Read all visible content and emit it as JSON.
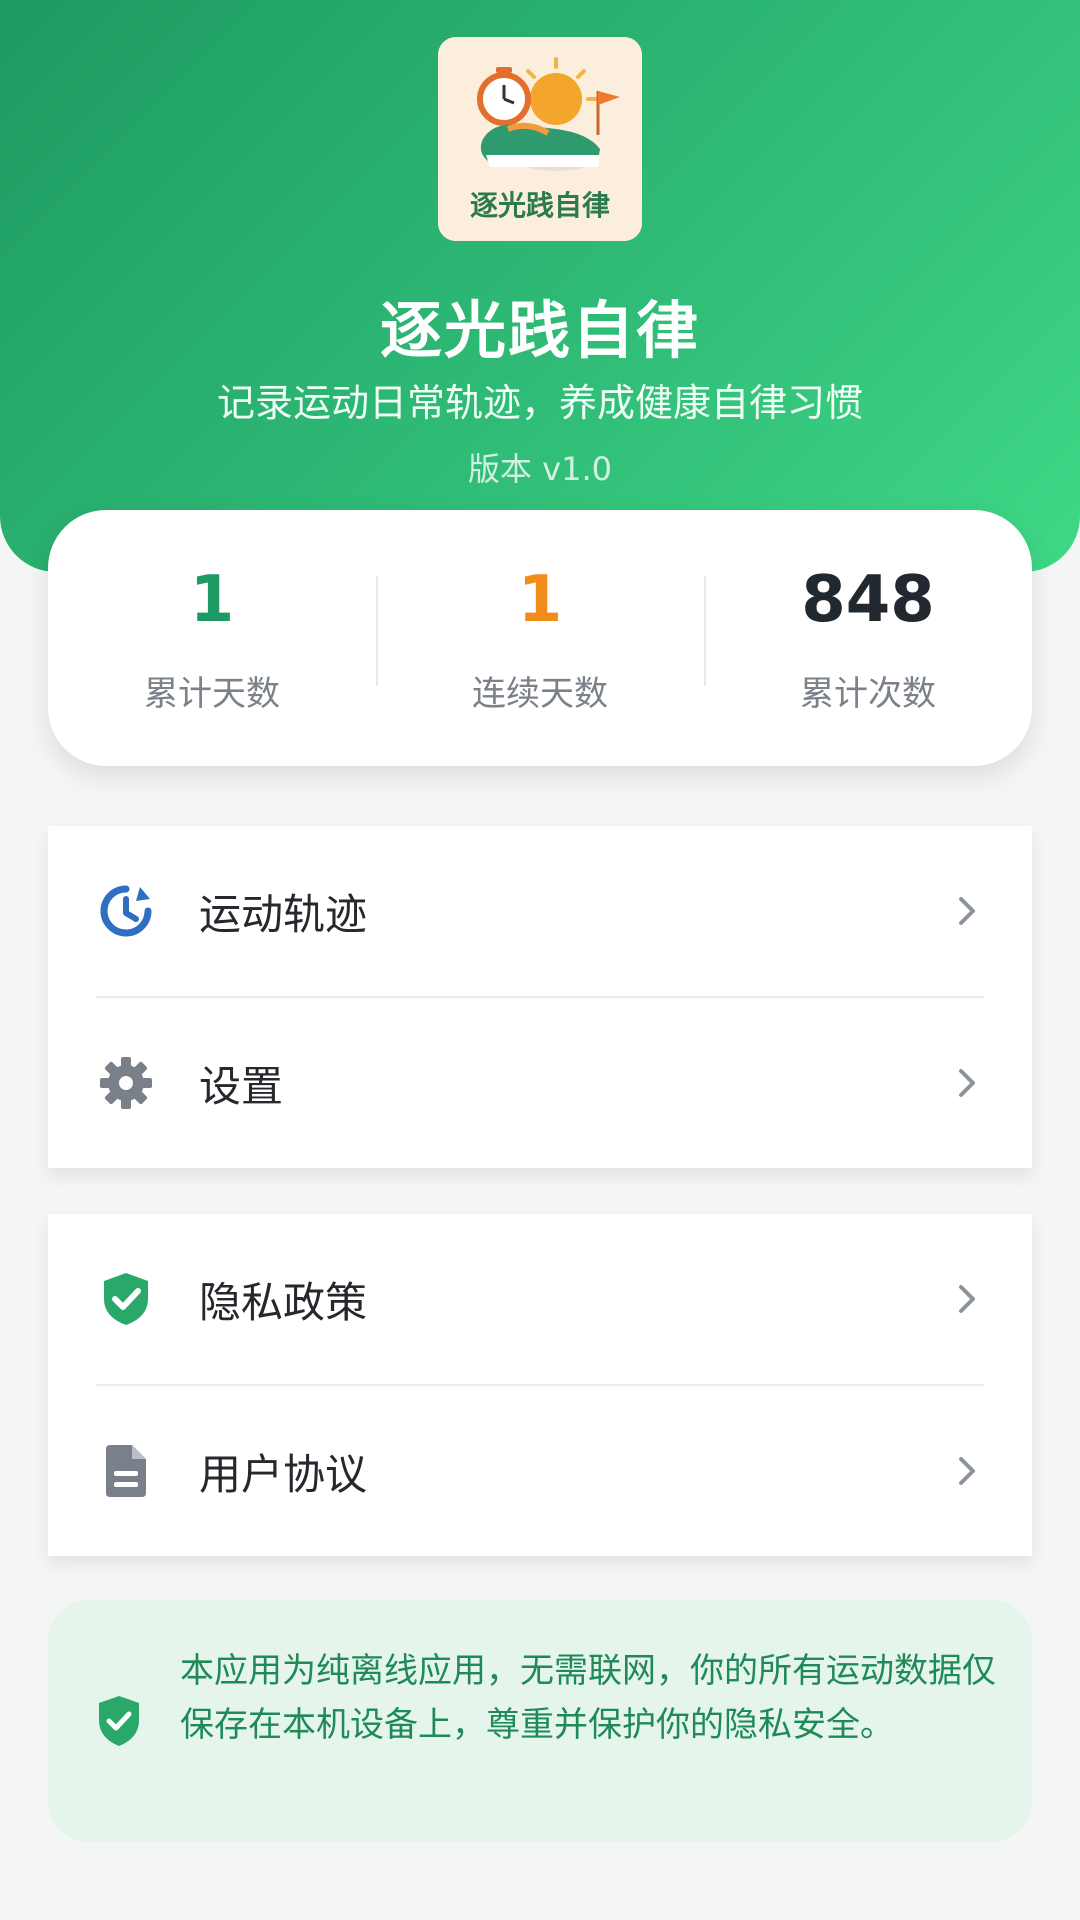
{
  "app": {
    "logo_text": "逐光践自律",
    "title": "逐光践自律",
    "subtitle": "记录运动日常轨迹，养成健康自律习惯",
    "version": "版本 v1.0"
  },
  "stats": [
    {
      "value": "1",
      "label": "累计天数",
      "color": "#1e9a63"
    },
    {
      "value": "1",
      "label": "连续天数",
      "color": "#f08c1a"
    },
    {
      "value": "848",
      "label": "累计次数",
      "color": "#222830"
    }
  ],
  "menu_group_1": [
    {
      "label": "运动轨迹",
      "icon": "history-icon",
      "icon_color": "#2f6fc2"
    },
    {
      "label": "设置",
      "icon": "gear-icon",
      "icon_color": "#7a8089"
    }
  ],
  "menu_group_2": [
    {
      "label": "隐私政策",
      "icon": "shield-check-icon",
      "icon_color": "#2aa86a"
    },
    {
      "label": "用户协议",
      "icon": "document-icon",
      "icon_color": "#7a8089"
    }
  ],
  "notice": {
    "text": "本应用为纯离线应用，无需联网，你的所有运动数据仅保存在本机设备上，尊重并保护你的隐私安全。",
    "icon": "shield-check-icon",
    "color": "#1e8a57"
  }
}
